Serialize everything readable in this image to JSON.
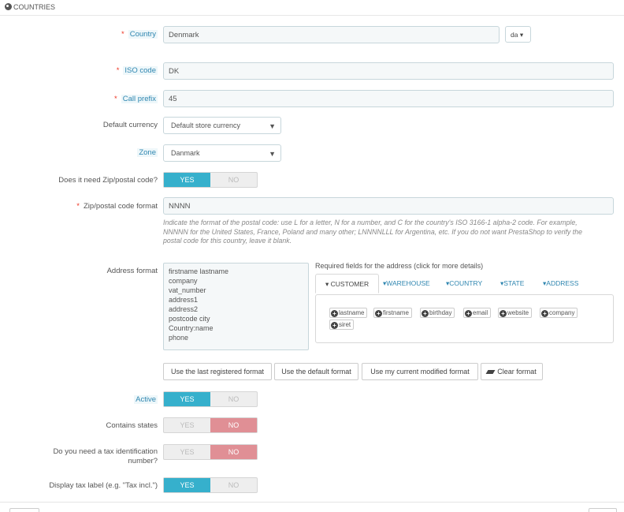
{
  "panel": {
    "title": "COUNTRIES"
  },
  "country": {
    "label": "Country",
    "value": "Denmark",
    "lang": "da"
  },
  "iso": {
    "label": "ISO code",
    "value": "DK"
  },
  "call_prefix": {
    "label": "Call prefix",
    "value": "45"
  },
  "default_currency": {
    "label": "Default currency",
    "value": "Default store currency"
  },
  "zone": {
    "label": "Zone",
    "value": "Danmark"
  },
  "need_zip": {
    "label": "Does it need Zip/postal code?",
    "yes": "YES",
    "no": "NO",
    "selected": "yes"
  },
  "zip_format": {
    "label": "Zip/postal code format",
    "value": "NNNN",
    "hint_lines": [
      "Indicate the format of the postal code: use L for a letter, N for a number, and C for the country's ISO 3166-1 alpha-2 code. For example,",
      "NNNNN for the United States, France, Poland and many other; LNNNNLLL for Argentina, etc. If you do not want PrestaShop to verify the",
      "postal code for this country, leave it blank."
    ]
  },
  "address_format": {
    "label": "Address format",
    "lines": [
      "firstname lastname",
      "company",
      "vat_number",
      "address1",
      "address2",
      "postcode city",
      "Country:name",
      "phone"
    ],
    "required_title": "Required fields for the address (click for more details)",
    "tabs": [
      "CUSTOMER",
      "WAREHOUSE",
      "COUNTRY",
      "STATE",
      "ADDRESS"
    ],
    "active_tab": "CUSTOMER",
    "fields": [
      "lastname",
      "firstname",
      "birthday",
      "email",
      "website",
      "company",
      "siret"
    ],
    "buttons": {
      "last_registered": "Use the last registered format",
      "default": "Use the default format",
      "current_modified": "Use my current modified format",
      "clear": "Clear format"
    }
  },
  "active": {
    "label": "Active",
    "yes": "YES",
    "no": "NO",
    "selected": "yes"
  },
  "contains_states": {
    "label": "Contains states",
    "yes": "YES",
    "no": "NO",
    "selected": "no"
  },
  "tax_id": {
    "label_line1": "Do you need a tax identification",
    "label_line2": "number?",
    "yes": "YES",
    "no": "NO",
    "selected": "no"
  },
  "tax_label": {
    "label": "Display tax label (e.g. \"Tax incl.\")",
    "yes": "YES",
    "no": "NO",
    "selected": "yes"
  },
  "colors": {
    "accent": "#36b0cc",
    "danger": "#e08f95",
    "link": "#2f86b0"
  }
}
